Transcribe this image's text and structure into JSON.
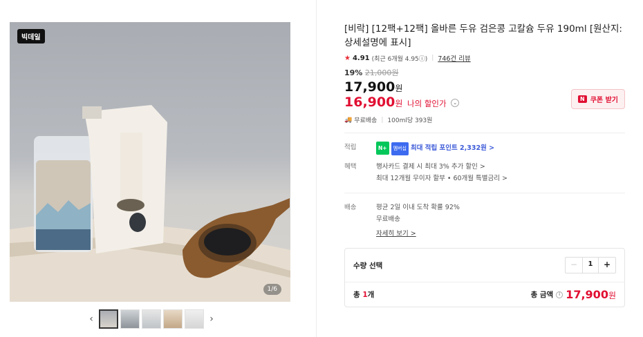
{
  "gallery": {
    "badge": "빅데일",
    "counter": "1/6",
    "prev_arrow": "‹",
    "next_arrow": "›",
    "thumb_count": 5
  },
  "product": {
    "title": "[비락] [12팩+12팩] 올바른 두유 검은콩 고칼슘 두유 190ml [원산지: 상세설명에 표시]",
    "rating": "4.91",
    "rating_note": "(최근 6개월 4.95ⓘ)",
    "review_link": "746건 리뷰",
    "discount_pct": "19%",
    "original_price": "21,000원",
    "price": "17,900",
    "price_unit": "원",
    "my_price": "16,900",
    "my_price_unit": "원",
    "my_price_label": "나의 할인가",
    "coupon_label": "쿠폰 받기",
    "shipping": "무료배송",
    "unit_price": "100ml당 393원"
  },
  "benefits": {
    "points_key": "적립",
    "points_badge1": "N+",
    "points_badge2": "멤버십",
    "points_text": "최대 적립 포인트 2,332원 >",
    "perks_key": "혜택",
    "perks_line1": "행사카드 결제 시 최대 3% 추가 할인 >",
    "perks_line2": "최대 12개월 무이자 할부 • 60개월 특별금리 >"
  },
  "delivery": {
    "key": "배송",
    "line1": "평균 2일 이내 도착 확률 92%",
    "line2": "무료배송",
    "link": "자세히 보기 >"
  },
  "order": {
    "qty_label": "수량 선택",
    "qty": "1",
    "minus": "−",
    "plus": "+",
    "count_prefix": "총 ",
    "count_num": "1",
    "count_suffix": "개",
    "total_label": "총 금액",
    "total_amount": "17,900",
    "total_unit": "원"
  },
  "colors": {
    "accent_red": "#e10f32",
    "point_blue": "#3d5bd9",
    "naver_green": "#03c75a"
  }
}
